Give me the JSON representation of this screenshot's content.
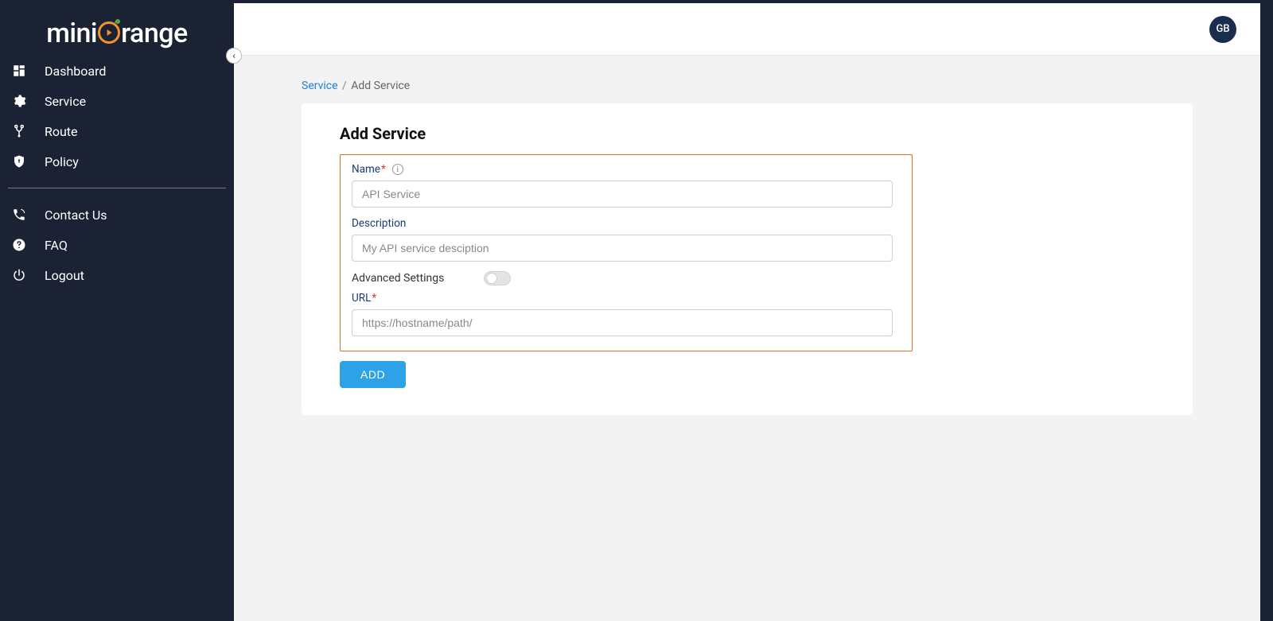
{
  "brand": {
    "name": "miniOrange",
    "prefix": "mini",
    "suffix": "range"
  },
  "header": {
    "avatar_initials": "GB"
  },
  "sidebar": {
    "items": [
      {
        "label": "Dashboard"
      },
      {
        "label": "Service"
      },
      {
        "label": "Route"
      },
      {
        "label": "Policy"
      }
    ],
    "bottom_items": [
      {
        "label": "Contact Us"
      },
      {
        "label": "FAQ"
      },
      {
        "label": "Logout"
      }
    ]
  },
  "breadcrumb": {
    "parent": "Service",
    "current": "Add Service"
  },
  "form": {
    "heading": "Add Service",
    "name_label": "Name",
    "name_placeholder": "API Service",
    "name_value": "",
    "description_label": "Description",
    "description_placeholder": "My API service desciption",
    "description_value": "",
    "advanced_label": "Advanced Settings",
    "advanced_on": false,
    "url_label": "URL",
    "url_placeholder": "https://hostname/path/",
    "url_value": "",
    "add_button": "ADD"
  },
  "colors": {
    "sidebar_bg": "#1b2233",
    "accent_orange": "#f1922c",
    "form_border": "#df6b25",
    "primary_button": "#2ea2e6",
    "link": "#1e7fd6"
  }
}
